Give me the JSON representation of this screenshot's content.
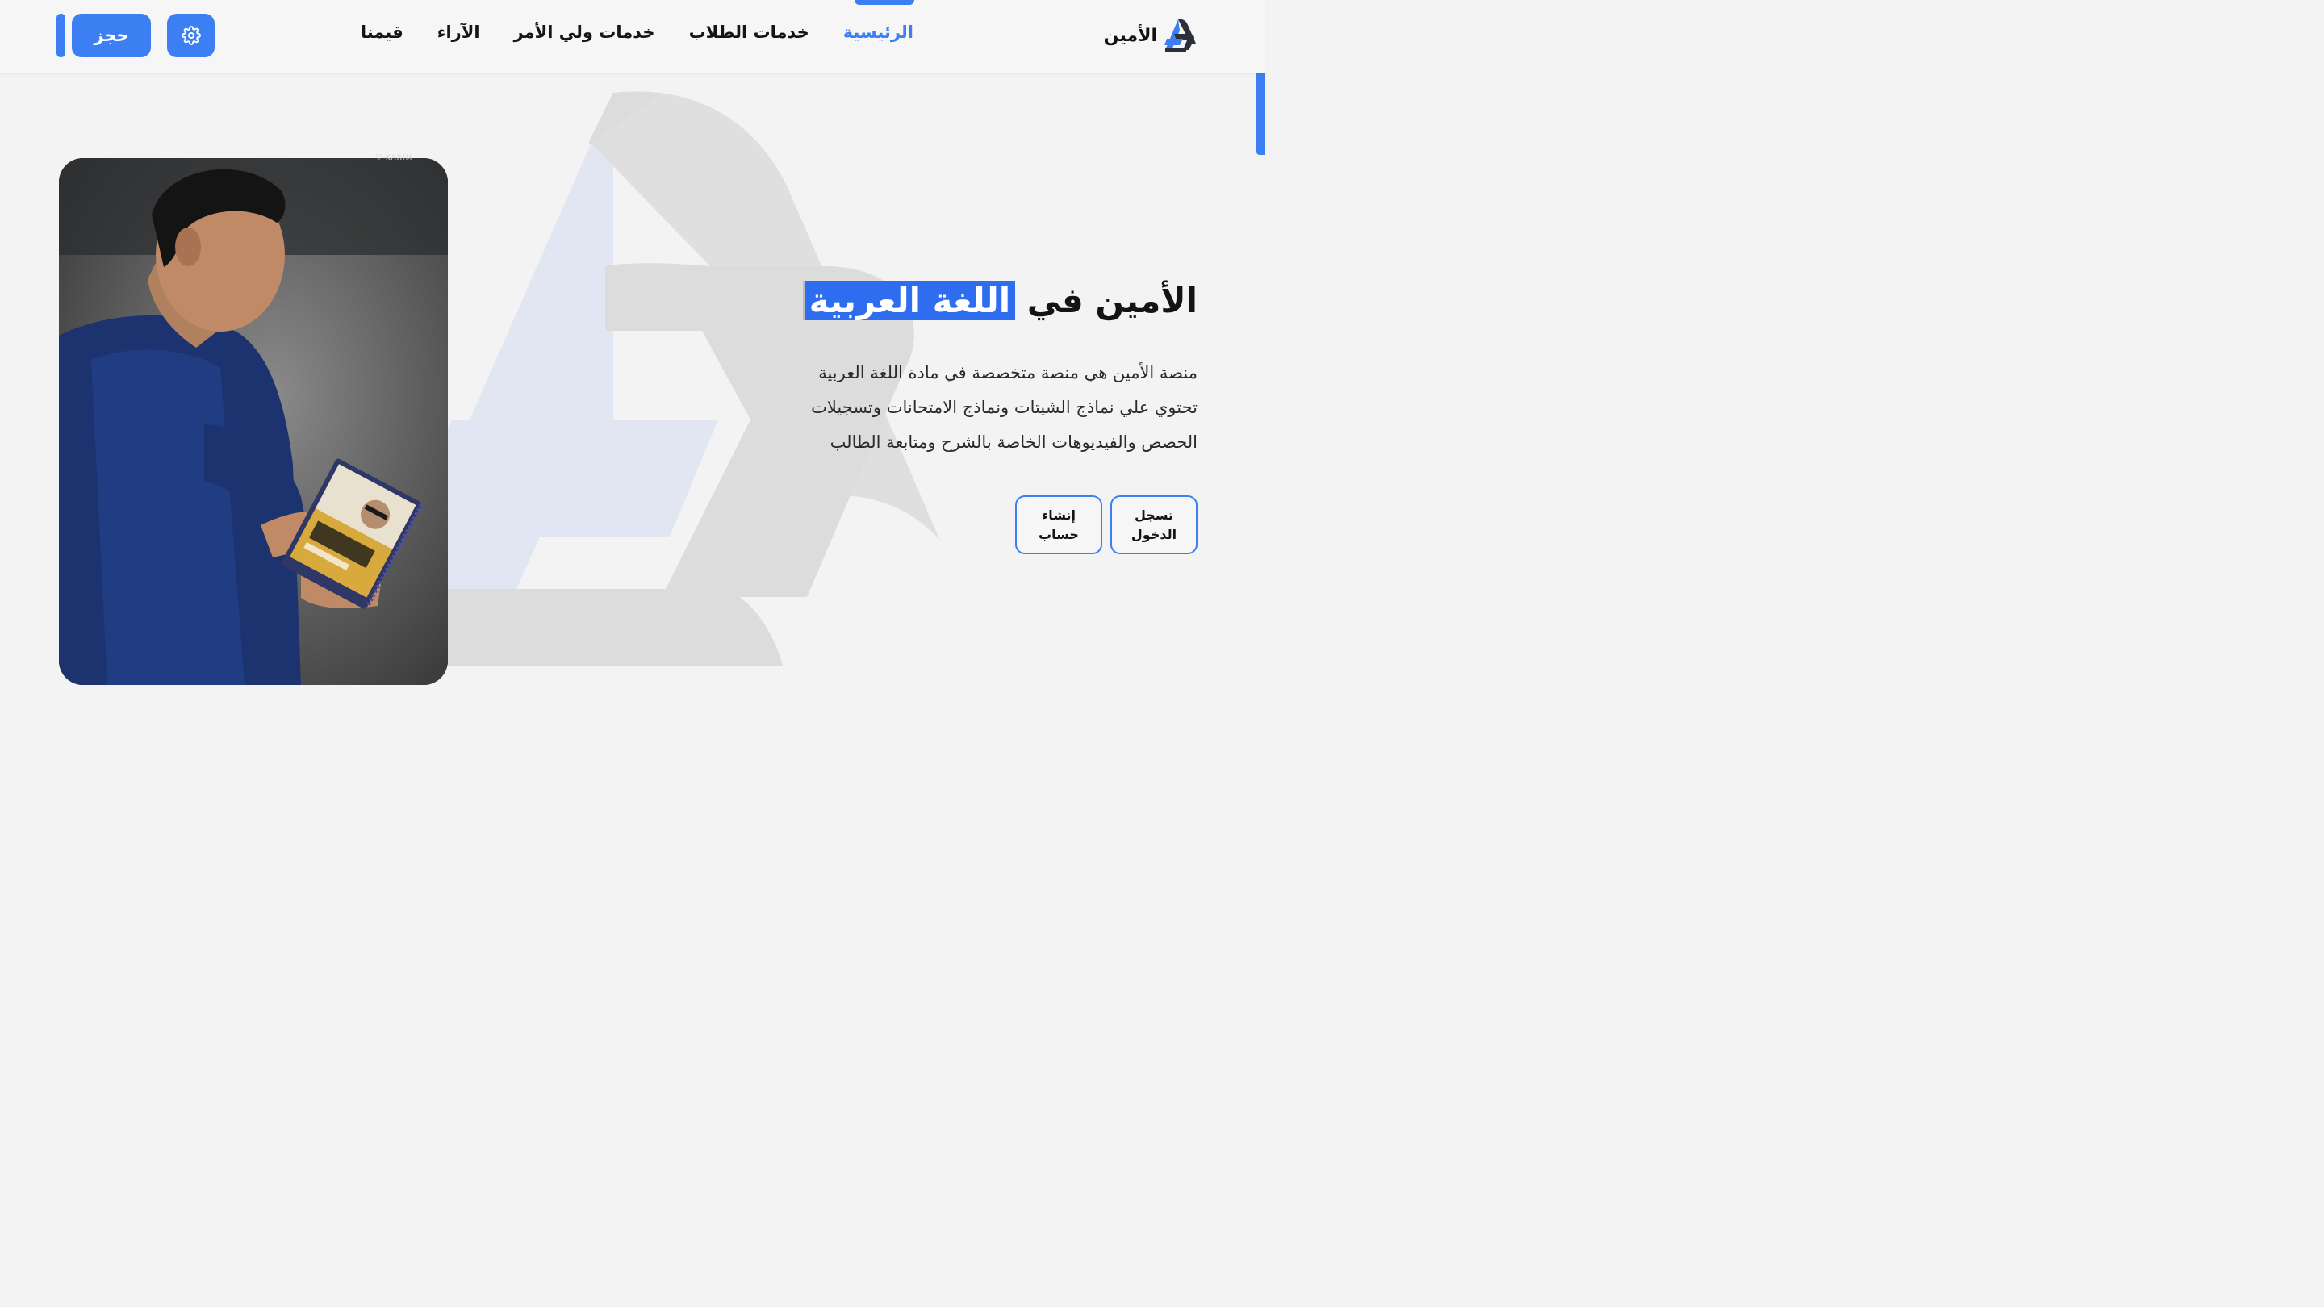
{
  "brand": {
    "name": "الأمين"
  },
  "nav": {
    "items": [
      {
        "label": "الرئيسية",
        "active": true
      },
      {
        "label": "خدمات الطلاب",
        "active": false
      },
      {
        "label": "خدمات ولي الأمر",
        "active": false
      },
      {
        "label": "الآراء",
        "active": false
      },
      {
        "label": "قيمنا",
        "active": false
      }
    ]
  },
  "header_actions": {
    "book_label": "حجز",
    "settings_icon": "gear-icon"
  },
  "hero": {
    "title_prefix": "الأمين في",
    "title_highlight": "اللغة العربية",
    "description": [
      "منصة الأمين هي منصة متخصصة في مادة اللغة العربية",
      "تحتوي علي نماذج الشيتات ونماذج الامتحانات وتسجيلات",
      "الحصص والفيديوهات الخاصة بالشرح ومتابعة الطالب"
    ],
    "login_label": [
      "تسجل",
      "الدخول"
    ],
    "register_label": [
      "إنشاء",
      "حساب"
    ],
    "photo_mark": "KARIM"
  },
  "colors": {
    "accent": "#3b7ff2",
    "background": "#f3f3f4",
    "text": "#141414"
  }
}
